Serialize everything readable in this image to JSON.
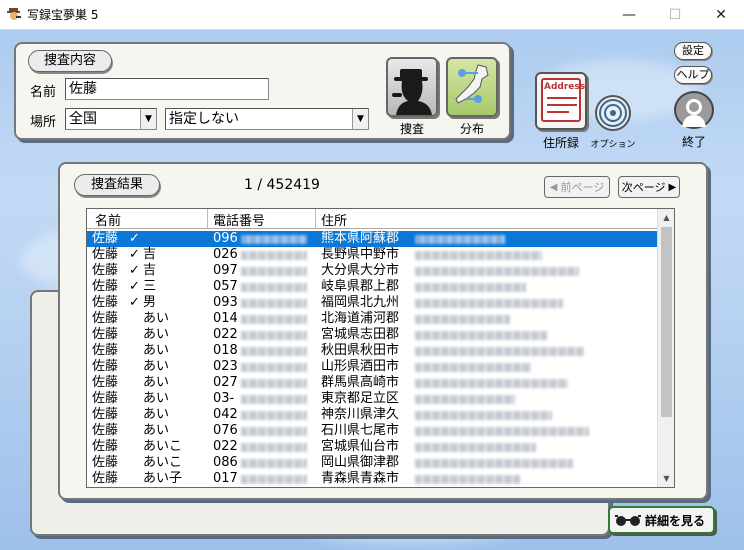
{
  "window": {
    "title": "写録宝夢巣 5",
    "minimize": "—",
    "maximize": "☐",
    "close": "✕"
  },
  "search_panel": {
    "header": "捜査内容",
    "name_label": "名前",
    "name_value": "佐藤",
    "place_label": "場所",
    "place_value": "全国",
    "place_sub_value": "指定しない",
    "search_button": "捜査",
    "distribution_button": "分布"
  },
  "right_tools": {
    "address_card_text": "Address",
    "address_book_label": "住所録",
    "option_label": "オプション",
    "settings_label": "設定",
    "help_label": "ヘルプ",
    "exit_label": "終了"
  },
  "results": {
    "header": "捜査結果",
    "counter": "1 / 452419",
    "prev_page": "前ページ",
    "next_page": "次ページ",
    "columns": [
      "名前",
      "電話番号",
      "住所"
    ],
    "rows": [
      {
        "name": "佐藤",
        "mark": "✓",
        "given": "",
        "phone": "096",
        "addr": "熊本県阿蘇郡",
        "selected": true
      },
      {
        "name": "佐藤",
        "mark": "✓",
        "given": "吉",
        "phone": "026",
        "addr": "長野県中野市",
        "selected": false
      },
      {
        "name": "佐藤",
        "mark": "✓",
        "given": "吉",
        "phone": "097",
        "addr": "大分県大分市",
        "selected": false
      },
      {
        "name": "佐藤",
        "mark": "✓",
        "given": "三",
        "phone": "057",
        "addr": "岐阜県郡上郡",
        "selected": false
      },
      {
        "name": "佐藤",
        "mark": "✓",
        "given": "男",
        "phone": "093",
        "addr": "福岡県北九州",
        "selected": false
      },
      {
        "name": "佐藤",
        "mark": "",
        "given": "あい",
        "phone": "014",
        "addr": "北海道浦河郡",
        "selected": false
      },
      {
        "name": "佐藤",
        "mark": "",
        "given": "あい",
        "phone": "022",
        "addr": "宮城県志田郡",
        "selected": false
      },
      {
        "name": "佐藤",
        "mark": "",
        "given": "あい",
        "phone": "018",
        "addr": "秋田県秋田市",
        "selected": false
      },
      {
        "name": "佐藤",
        "mark": "",
        "given": "あい",
        "phone": "023",
        "addr": "山形県酒田市",
        "selected": false
      },
      {
        "name": "佐藤",
        "mark": "",
        "given": "あい",
        "phone": "027",
        "addr": "群馬県高崎市",
        "selected": false
      },
      {
        "name": "佐藤",
        "mark": "",
        "given": "あい",
        "phone": "03-",
        "addr": "東京都足立区",
        "selected": false
      },
      {
        "name": "佐藤",
        "mark": "",
        "given": "あい",
        "phone": "042",
        "addr": "神奈川県津久",
        "selected": false
      },
      {
        "name": "佐藤",
        "mark": "",
        "given": "あい",
        "phone": "076",
        "addr": "石川県七尾市",
        "selected": false
      },
      {
        "name": "佐藤",
        "mark": "",
        "given": "あいこ",
        "phone": "022",
        "addr": "宮城県仙台市",
        "selected": false
      },
      {
        "name": "佐藤",
        "mark": "",
        "given": "あいこ",
        "phone": "086",
        "addr": "岡山県御津郡",
        "selected": false
      },
      {
        "name": "佐藤",
        "mark": "",
        "given": "あい子",
        "phone": "017",
        "addr": "青森県青森市",
        "selected": false
      }
    ]
  },
  "detail_button": "詳細を見る",
  "icons": {
    "app": "detective-icon",
    "search": "detective-silhouette-icon",
    "distribution": "japan-map-icon",
    "address_book": "address-book-icon",
    "option": "target-icon",
    "exit": "user-exit-icon",
    "glasses": "glasses-icon"
  },
  "colors": {
    "selection": "#0a78d7",
    "panel": "#f6f6f1",
    "detail_button_border": "#2e7d32"
  }
}
